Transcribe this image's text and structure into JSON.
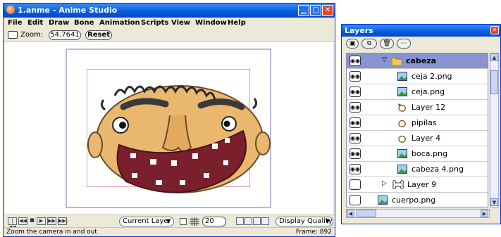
{
  "window": {
    "title": "1.anme - Anime Studio",
    "controls": [
      "minimize-icon",
      "maximize-icon",
      "close-icon"
    ]
  },
  "menu": [
    "File",
    "Edit",
    "Draw",
    "Bone",
    "Animation",
    "Scripts",
    "View",
    "Window",
    "Help"
  ],
  "toolbar": {
    "zoom_label": "Zoom:",
    "zoom_value": "54.7641",
    "reset_label": "Reset"
  },
  "playback": {
    "buttons": [
      "rewind-icon",
      "step-back-icon",
      "stop-icon",
      "play-icon",
      "step-forward-icon",
      "forward-end-icon"
    ],
    "layer_mode": "Current Layer",
    "grid_size": "20",
    "quality": "Display Quality"
  },
  "status": {
    "message": "Zoom the camera in and out",
    "frame": "Frame: 892"
  },
  "layers_panel": {
    "title": "Layers",
    "toolbar_icons": [
      "new-layer-icon",
      "duplicate-layer-icon",
      "delete-layer-icon",
      "more-options-icon"
    ],
    "rows": [
      {
        "label": "cabeza",
        "type": "group",
        "selected": true,
        "visible": true
      },
      {
        "label": "ceja 2.png",
        "type": "image",
        "selected": false,
        "visible": true
      },
      {
        "label": "ceja.png",
        "type": "image",
        "selected": false,
        "visible": true
      },
      {
        "label": "Layer 12",
        "type": "vector",
        "selected": false,
        "visible": true
      },
      {
        "label": "pipilas",
        "type": "vector",
        "selected": false,
        "visible": true
      },
      {
        "label": "Layer 4",
        "type": "vector",
        "selected": false,
        "visible": true
      },
      {
        "label": "boca.png",
        "type": "image",
        "selected": false,
        "visible": true
      },
      {
        "label": "cabeza 4.png",
        "type": "image",
        "selected": false,
        "visible": true
      },
      {
        "label": "Layer 9",
        "type": "bone",
        "selected": false,
        "visible": false
      },
      {
        "label": "cuerpo.png",
        "type": "image",
        "selected": false,
        "visible": false
      }
    ]
  },
  "colors": {
    "titlebar": "#0a5fe0",
    "selected_row": "#8893d0",
    "face": "#e9b86e",
    "mouth": "#7a1f2c"
  }
}
